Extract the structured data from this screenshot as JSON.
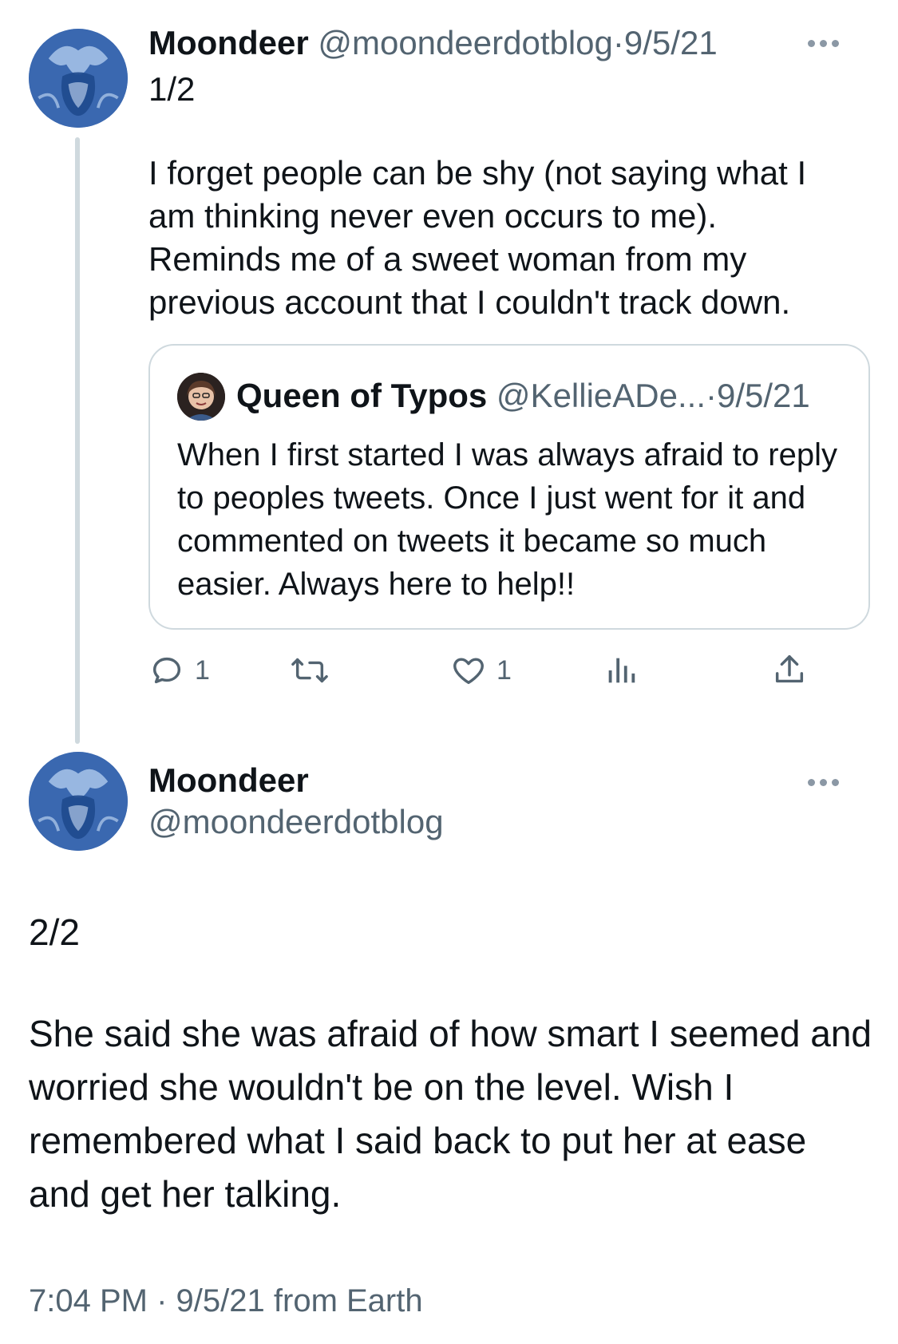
{
  "tweet1": {
    "author_name": "Moondeer",
    "author_handle": "@moondeerdotblog",
    "separator": "·",
    "date": "9/5/21",
    "counter": "1/2",
    "text": "I forget people can be shy (not saying what I am thinking never even occurs to me). Reminds me of a sweet woman from my previous account that I couldn't track down.",
    "more_icon": "more-horizontal-icon",
    "quote": {
      "author_name": "Queen of Typos",
      "author_handle": "@KellieADe...",
      "separator": "·",
      "date": "9/5/21",
      "text": "When I first started I was always afraid to reply to peoples tweets.  Once I just went for it and commented on tweets it became so much easier.  Always here to help!!"
    },
    "actions": {
      "reply_count": "1",
      "retweet_count": "",
      "like_count": "1",
      "views_count": ""
    }
  },
  "tweet2": {
    "author_name": "Moondeer",
    "author_handle": "@moondeerdotblog",
    "counter": "2/2",
    "text": "She said she was afraid of how smart I seemed and worried she wouldn't be on the level. Wish I remembered what I said back to  put her at ease and get her talking.",
    "time": "7:04 PM",
    "separator": "·",
    "date": "9/5/21",
    "source": "from Earth"
  },
  "colors": {
    "text_primary": "#0f1419",
    "text_secondary": "#536471",
    "border": "#cfd9de",
    "avatar_blue": "#2f5ea8"
  }
}
